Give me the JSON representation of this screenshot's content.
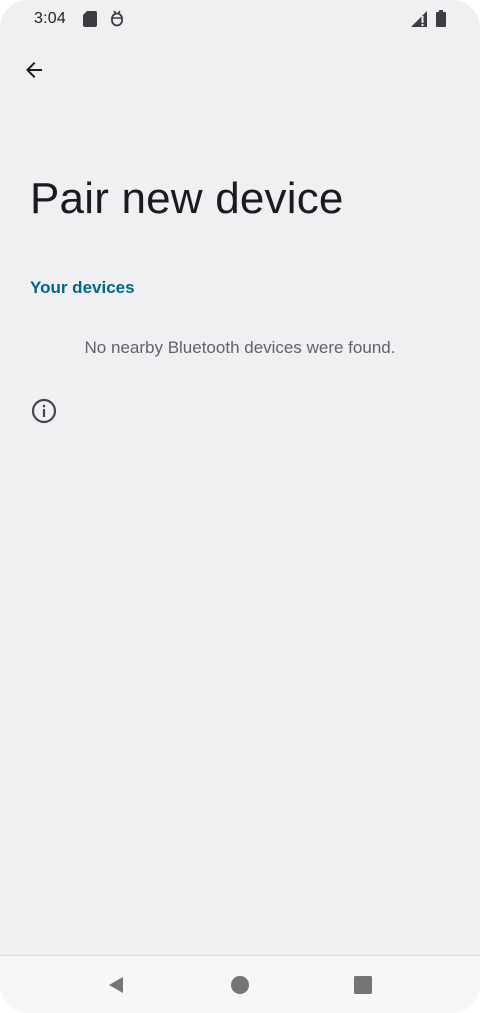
{
  "status_bar": {
    "time": "3:04",
    "icons": [
      "sd-card-icon",
      "debug-icon",
      "signal-icon",
      "battery-icon"
    ]
  },
  "toolbar": {
    "back_icon": "arrow-back-icon"
  },
  "page": {
    "title": "Pair new device",
    "section_header": "Your devices",
    "empty_message": "No nearby Bluetooth devices were found.",
    "info_icon": "info-icon"
  },
  "nav_bar": {
    "buttons": [
      "back-triangle-icon",
      "home-circle-icon",
      "recents-square-icon"
    ]
  },
  "colors": {
    "background": "#f0f0f3",
    "accent": "#00668a",
    "title": "#1b1b1f",
    "secondary_text": "#5f6368"
  }
}
